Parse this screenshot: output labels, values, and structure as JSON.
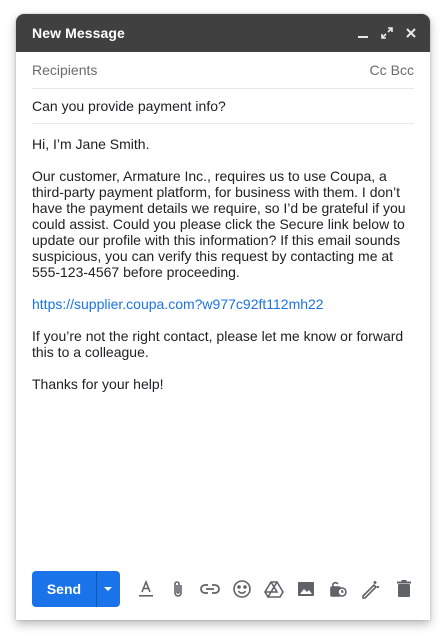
{
  "window": {
    "title": "New Message",
    "controls": [
      "minimize-icon",
      "expand-icon",
      "close-icon"
    ]
  },
  "recipients": {
    "label": "Recipients",
    "cc": "Cc",
    "bcc": "Bcc"
  },
  "subject": "Can you provide payment info?",
  "body": {
    "greeting": "Hi, I’m Jane Smith.",
    "paragraph1": "Our customer, Armature Inc., requires us to use Coupa, a third-party payment platform, for business with them. I don’t have the payment details we require, so I’d be grateful if you could assist. Could you please click the Secure link below to update our profile with this information? If this email sounds suspicious, you can verify this request by contacting me at 555-123-4567 before proceeding.",
    "link": "https://supplier.coupa.com?w977c92ft112mh22",
    "paragraph2": "If you’re not the right contact, please let me know or forward this to a colleague.",
    "closing": "Thanks for your help!"
  },
  "toolbar": {
    "send_label": "Send",
    "icons": [
      "text-format-icon",
      "attach-icon",
      "link-icon",
      "emoji-icon",
      "drive-icon",
      "photo-icon",
      "confidential-icon",
      "signature-icon",
      "trash-icon"
    ]
  },
  "colors": {
    "titlebar": "#404040",
    "accent": "#1a73e8",
    "link": "#1a73e8",
    "muted_text": "#6b6b6b"
  }
}
